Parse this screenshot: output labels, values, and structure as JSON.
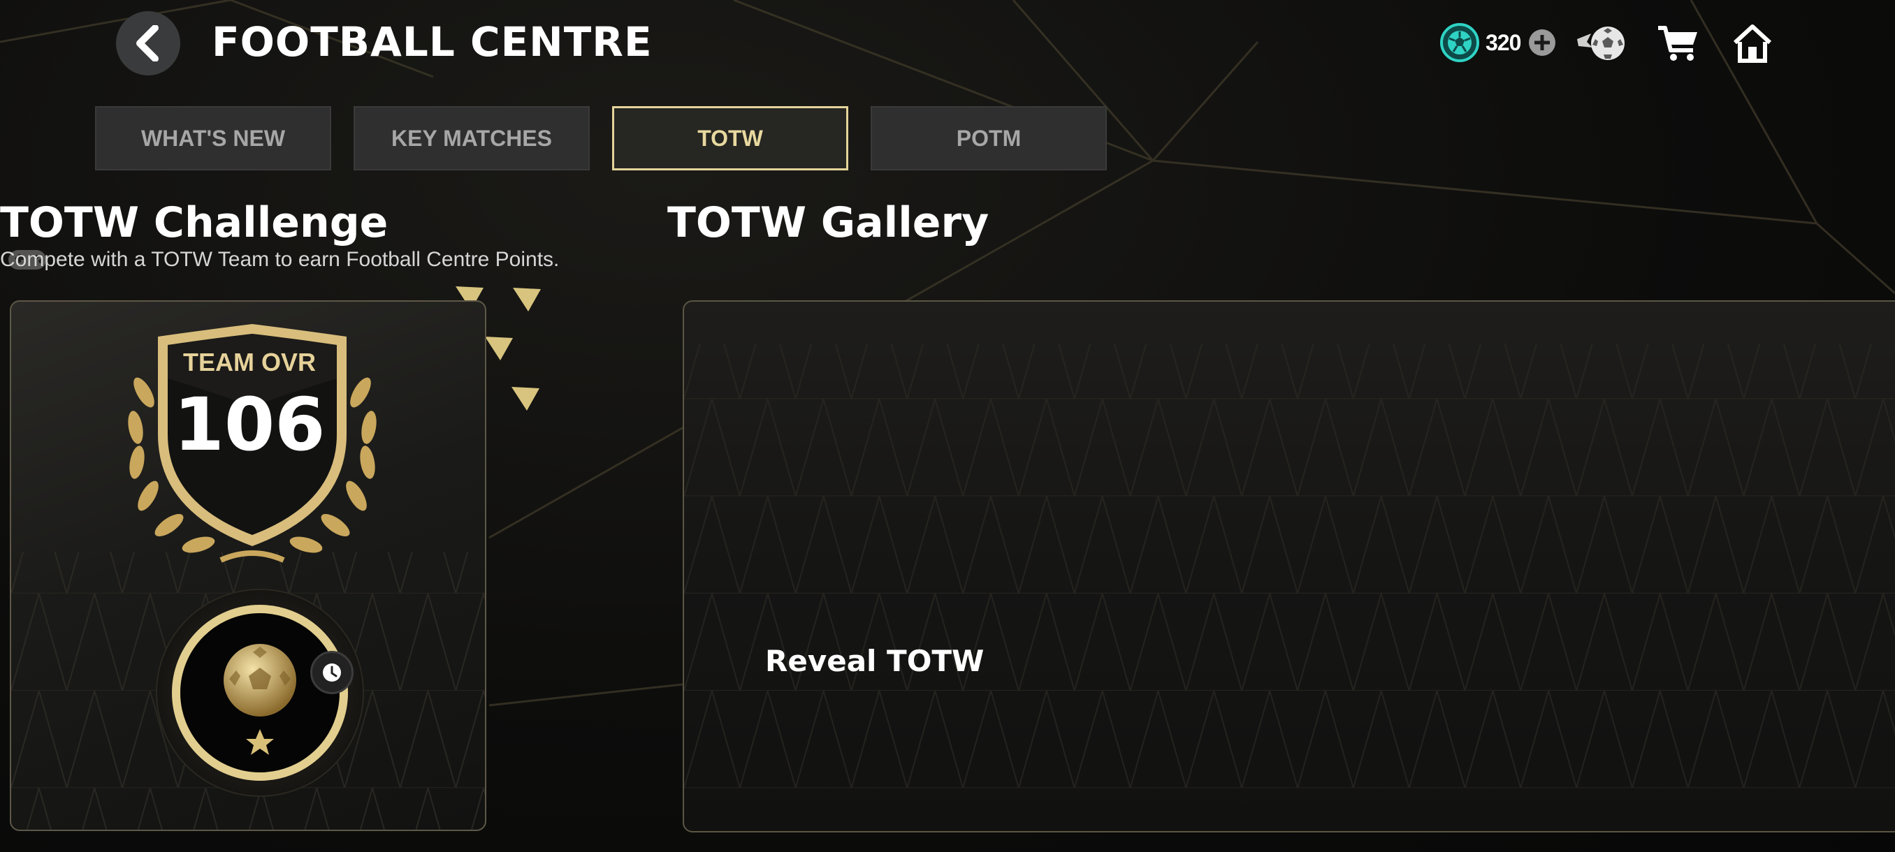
{
  "header": {
    "title": "FOOTBALL CENTRE",
    "currency_value": "320"
  },
  "tabs": [
    {
      "label": "WHAT'S NEW",
      "active": false
    },
    {
      "label": "KEY MATCHES",
      "active": false
    },
    {
      "label": "TOTW",
      "active": true
    },
    {
      "label": "POTM",
      "active": false
    }
  ],
  "challenge": {
    "title": "TOTW Challenge",
    "description": "Compete with a TOTW Team to earn Football Centre Points.",
    "ovr_label": "TEAM OVR",
    "ovr_value": "106"
  },
  "gallery": {
    "title": "TOTW Gallery",
    "reveal_label": "Reveal TOTW"
  },
  "colors": {
    "gold": "#e4d49a",
    "currency_teal": "#2fd3c4",
    "tab_bg": "#2f2f2f",
    "background": "#0b0b0b"
  },
  "icons": {
    "back": "chevron-left-icon",
    "currency": "football-points-icon",
    "add": "plus-circle-icon",
    "rewards": "ball-rewards-icon",
    "store": "cart-icon",
    "home": "home-icon",
    "timer": "clock-icon"
  }
}
